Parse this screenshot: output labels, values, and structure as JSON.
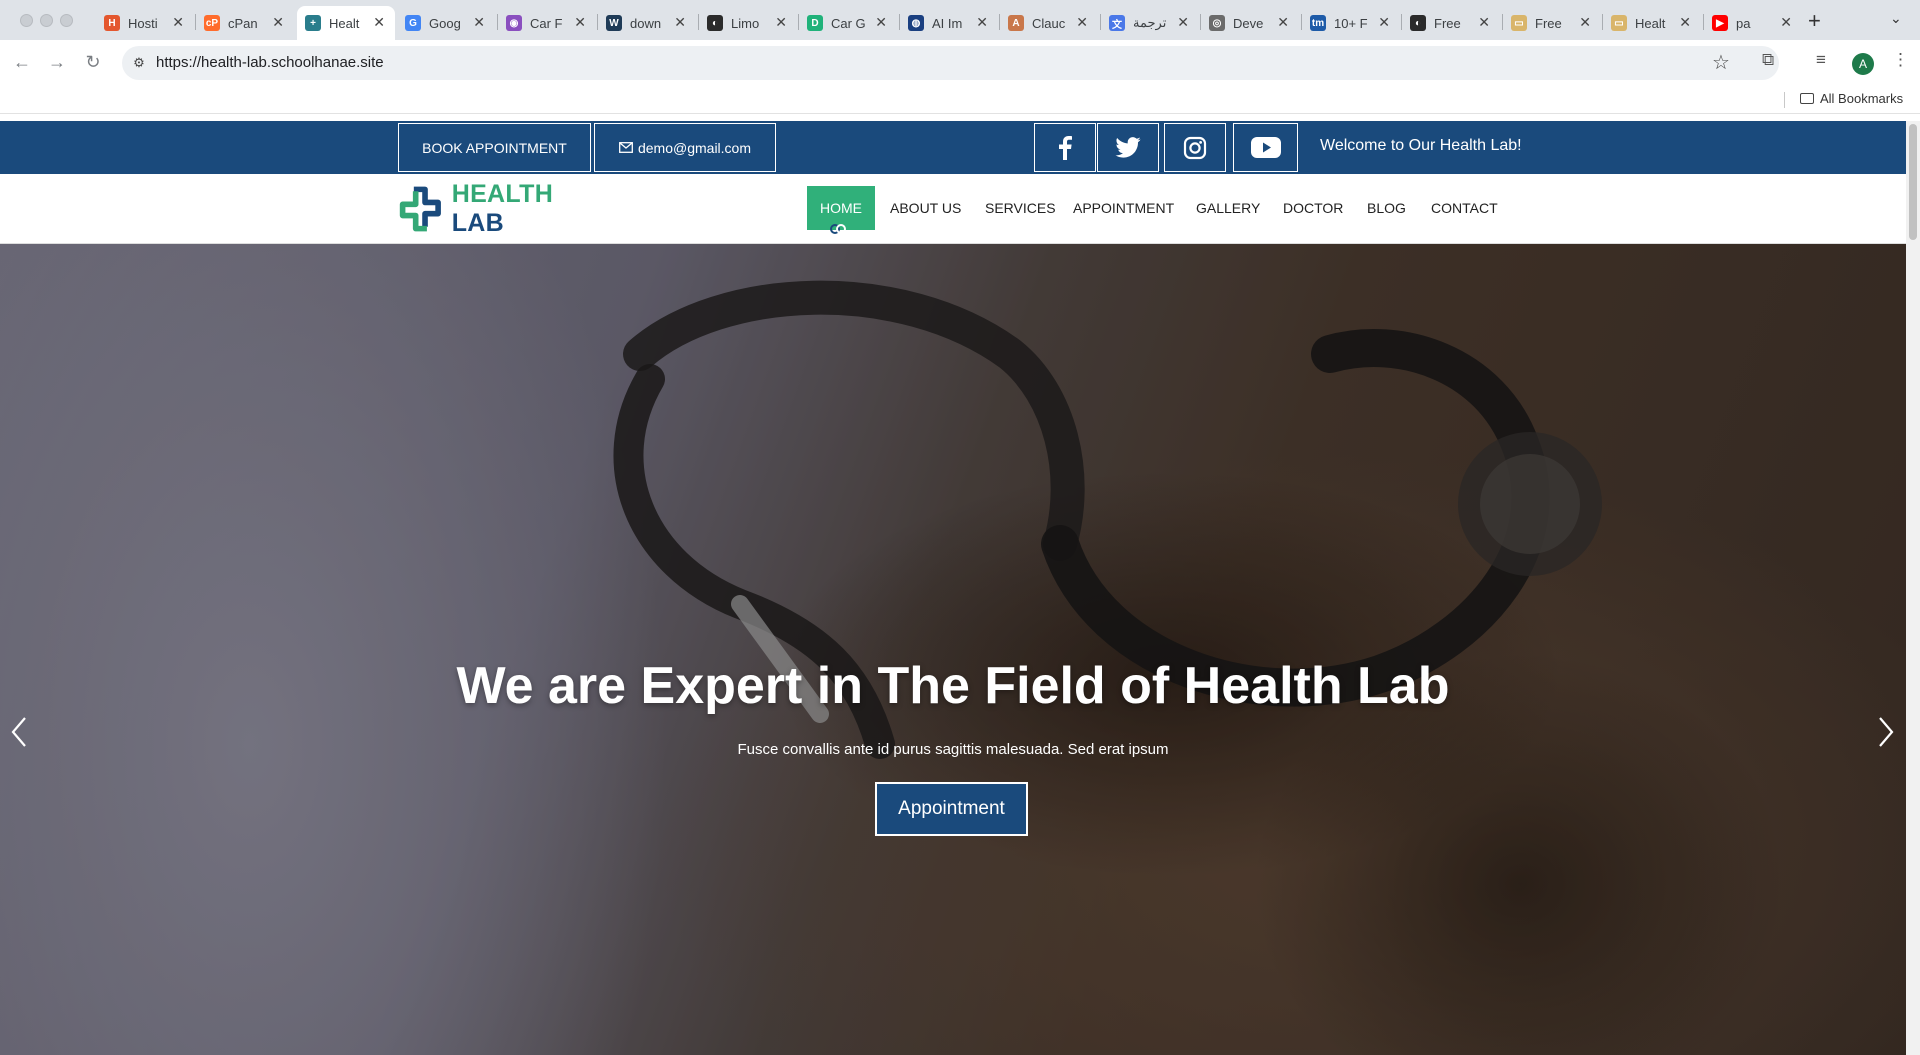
{
  "browser": {
    "tabs": [
      {
        "label": "Hosti",
        "icon": "hostinger-icon",
        "color": "#e4572e",
        "glyph": "H"
      },
      {
        "label": "cPan",
        "icon": "cpanel-icon",
        "color": "#ff6c2c",
        "glyph": "cP"
      },
      {
        "label": "Healt",
        "icon": "health-lab-icon",
        "color": "#2a7d8c",
        "glyph": "+"
      },
      {
        "label": "Goog",
        "icon": "google-icon",
        "color": "#4285f4",
        "glyph": "G"
      },
      {
        "label": "Car F",
        "icon": "eye-icon",
        "color": "#8a4fbf",
        "glyph": "◉"
      },
      {
        "label": "down",
        "icon": "w3schools-icon",
        "color": "#1f3b57",
        "glyph": "W"
      },
      {
        "label": "Limo",
        "icon": "limo-icon",
        "color": "#2b2b2b",
        "glyph": "◐"
      },
      {
        "label": "Car G",
        "icon": "car-g-icon",
        "color": "#20b27a",
        "glyph": "D"
      },
      {
        "label": "AI Im",
        "icon": "ai-image-icon",
        "color": "#1a3f80",
        "glyph": "◍"
      },
      {
        "label": "Clauc",
        "icon": "claude-icon",
        "color": "#c9774a",
        "glyph": "A"
      },
      {
        "label": "ترجمة",
        "icon": "translate-icon",
        "color": "#4a78e8",
        "glyph": "文"
      },
      {
        "label": "Deve",
        "icon": "globe-icon",
        "color": "#6b6b6b",
        "glyph": "◎"
      },
      {
        "label": "10+ F",
        "icon": "tm-icon",
        "color": "#1e5ba8",
        "glyph": "tm"
      },
      {
        "label": "Free",
        "icon": "free-icon",
        "color": "#2b2b2b",
        "glyph": "◐"
      },
      {
        "label": "Free",
        "icon": "template-icon",
        "color": "#d9b56a",
        "glyph": "▭"
      },
      {
        "label": "Healt",
        "icon": "template-icon",
        "color": "#d9b56a",
        "glyph": "▭"
      },
      {
        "label": "pa",
        "icon": "youtube-icon",
        "color": "#ff0000",
        "glyph": "▶"
      }
    ],
    "url": "https://health-lab.schoolhanae.site",
    "profile_initial": "A",
    "all_bookmarks": "All Bookmarks"
  },
  "topbar": {
    "book_label": "BOOK APPOINTMENT",
    "email": "demo@gmail.com",
    "welcome": "Welcome to Our Health Lab!"
  },
  "logo": {
    "part1": "HEALTH",
    "part2": "LAB"
  },
  "nav": {
    "home": "HOME",
    "about": "ABOUT US",
    "services": "SERVICES",
    "appointment": "APPOINTMENT",
    "gallery": "GALLERY",
    "doctor": "DOCTOR",
    "blog": "BLOG",
    "contact": "CONTACT"
  },
  "hero": {
    "title": "We are Expert in The Field of Health Lab",
    "subtitle": "Fusce convallis ante id purus sagittis malesuada. Sed erat ipsum",
    "button": "Appointment"
  },
  "colors": {
    "primary": "#1a4a7c",
    "accent": "#30b07a"
  }
}
